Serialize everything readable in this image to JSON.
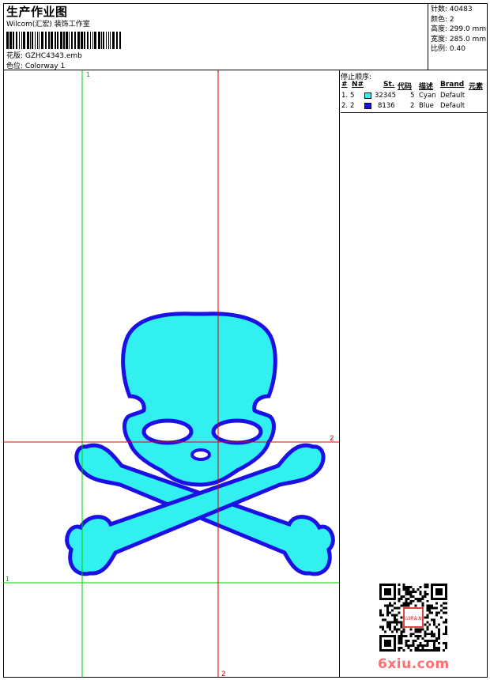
{
  "header": {
    "title": "生产作业图",
    "company": "Wilcom(汇宏) 装饰工作室",
    "design_label": "花版: GZHC4343.emb",
    "colorway_label": "色位: Colorway 1"
  },
  "info": [
    {
      "label": "针数:",
      "value": "40483"
    },
    {
      "label": "颜色:",
      "value": "2"
    },
    {
      "label": "高度:",
      "value": "299.0 mm"
    },
    {
      "label": "宽度:",
      "value": "285.0 mm"
    },
    {
      "label": "比例:",
      "value": "0.40"
    }
  ],
  "stop_sequence": {
    "title": "停止顺序:",
    "columns": [
      "#",
      "N#",
      "St.",
      "代码",
      "描述",
      "Brand",
      "元素"
    ],
    "rows": [
      {
        "idx": "1.",
        "n": "5",
        "color": "#33f0f0",
        "stitches": "32345",
        "code": "5",
        "desc": "Cyan",
        "brand": "Default"
      },
      {
        "idx": "2.",
        "n": "2",
        "color": "#1010e0",
        "stitches": "8136",
        "code": "2",
        "desc": "Blue",
        "brand": "Default"
      }
    ]
  },
  "guides": {
    "green_v_label": "1",
    "green_h_label": "1",
    "red_v_label": "2",
    "red_h_label": "2"
  },
  "design_colors": {
    "fill": "#33f0f0",
    "outline": "#1a10e6",
    "green": "#00cc00",
    "red": "#dd0000"
  },
  "watermark": "6xiu.com",
  "qr_stamp_text": "以绣会友"
}
